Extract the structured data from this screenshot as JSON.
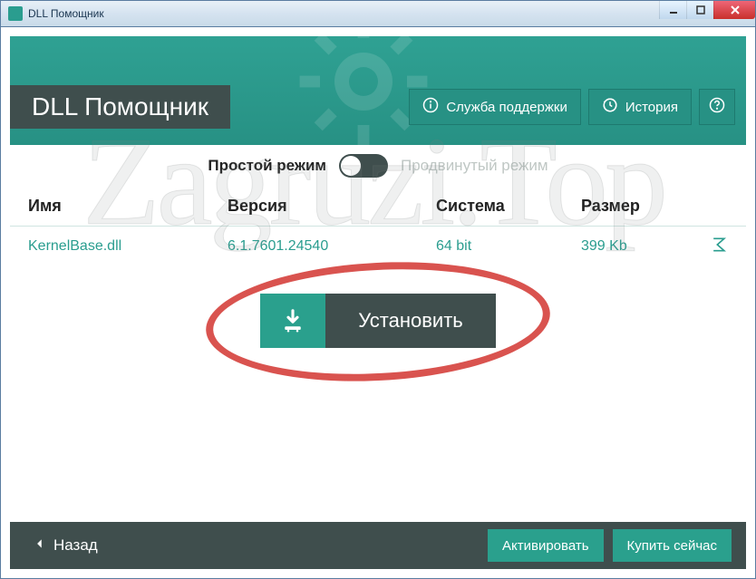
{
  "window": {
    "title": "DLL Помощник"
  },
  "header": {
    "app_title": "DLL Помощник",
    "support_label": "Служба поддержки",
    "history_label": "История"
  },
  "mode": {
    "simple_label": "Простой режим",
    "advanced_label": "Продвинутый режим",
    "active": "simple"
  },
  "table": {
    "columns": {
      "name": "Имя",
      "version": "Версия",
      "system": "Система",
      "size": "Размер"
    },
    "rows": [
      {
        "name": "KernelBase.dll",
        "version": "6.1.7601.24540",
        "system": "64 bit",
        "size": "399 Kb"
      }
    ]
  },
  "install": {
    "label": "Установить"
  },
  "footer": {
    "back_label": "Назад",
    "activate_label": "Активировать",
    "buy_label": "Купить сейчас"
  },
  "watermark": "Zagruzi.Top"
}
